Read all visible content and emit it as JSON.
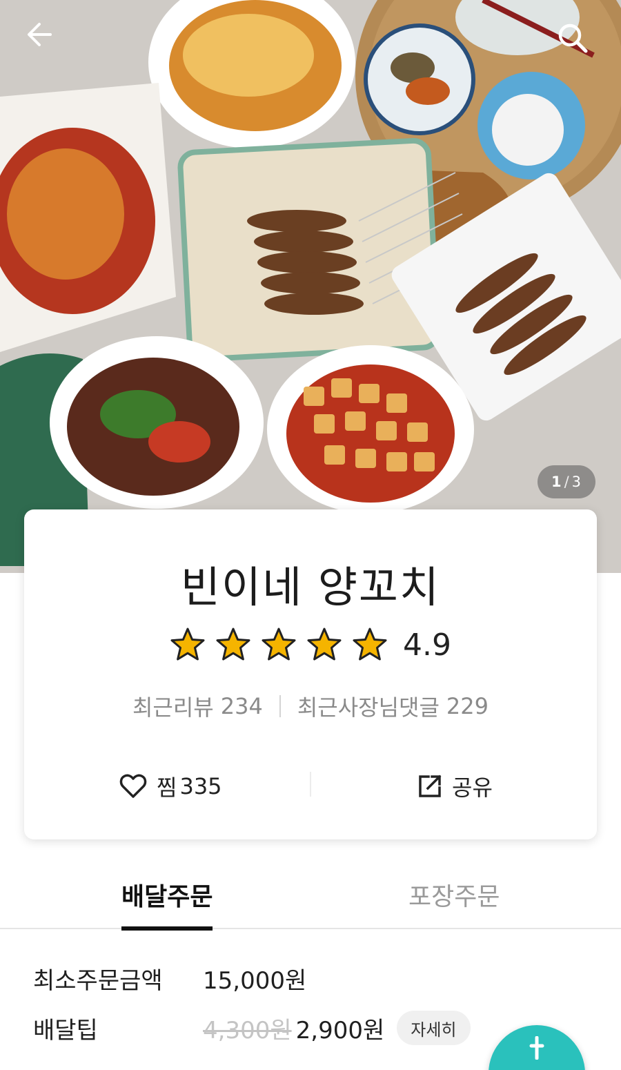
{
  "header": {
    "back_icon": "arrow-left-icon",
    "search_icon": "search-icon",
    "image_counter": {
      "current": "1",
      "separator": "/",
      "total": "3"
    }
  },
  "store": {
    "name": "빈이네 양꼬치",
    "rating": {
      "stars": 5,
      "value": "4.9"
    },
    "reviews": {
      "label": "최근리뷰",
      "count": "234"
    },
    "owner_replies": {
      "label": "최근사장님댓글",
      "count": "229"
    },
    "like": {
      "icon": "heart-icon",
      "label": "찜",
      "count": "335"
    },
    "share": {
      "icon": "share-icon",
      "label": "공유"
    }
  },
  "tabs": {
    "delivery": "배달주문",
    "pickup": "포장주문",
    "active": "delivery"
  },
  "delivery_info": {
    "min_order": {
      "label": "최소주문금액",
      "value": "15,000원"
    },
    "tip": {
      "label": "배달팁",
      "old_value": "4,300원",
      "value": "2,900원",
      "detail_button": "자세히"
    }
  },
  "colors": {
    "accent": "#2ac1bc",
    "star": "#f5b400",
    "text_primary": "#1f1f1f",
    "text_secondary": "#8a8a8a"
  }
}
